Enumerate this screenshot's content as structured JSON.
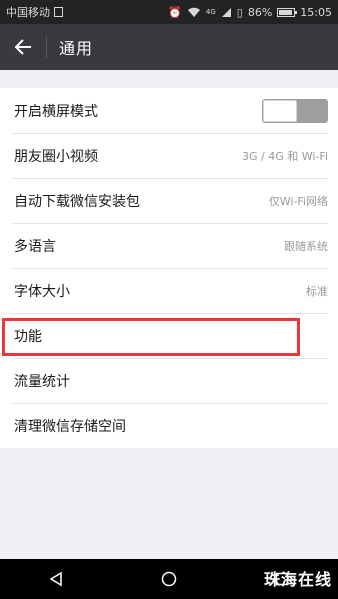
{
  "status_bar": {
    "carrier": "中国移动",
    "signal_label": "4G",
    "battery_percent": "86%",
    "time": "15:05"
  },
  "header": {
    "title": "通用"
  },
  "settings": [
    {
      "label": "开启横屏模式",
      "value": ""
    },
    {
      "label": "朋友圈小视频",
      "value": "3G / 4G 和 Wi-Fi"
    },
    {
      "label": "自动下载微信安装包",
      "value": "仅Wi-Fi网络"
    },
    {
      "label": "多语言",
      "value": "跟随系统"
    },
    {
      "label": "字体大小",
      "value": "标准"
    },
    {
      "label": "功能",
      "value": ""
    },
    {
      "label": "流量统计",
      "value": ""
    },
    {
      "label": "清理微信存储空间",
      "value": ""
    }
  ],
  "toggle_landscape": {
    "on": false
  },
  "highlight": {
    "color": "#e8393a"
  },
  "watermark": "珠海在线",
  "colors": {
    "status_bar": "#232323",
    "title_bar": "#393a3f",
    "background": "#efeff4"
  }
}
